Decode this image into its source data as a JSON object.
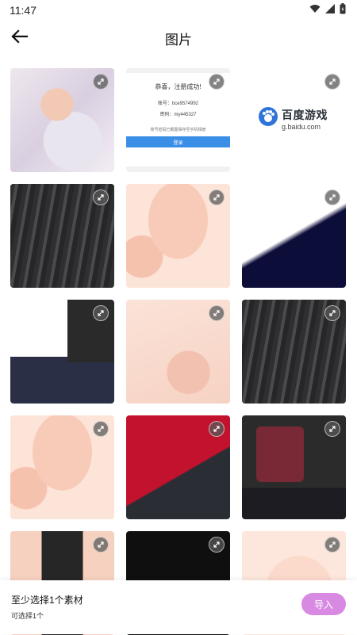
{
  "status_bar": {
    "time": "11:47",
    "icons": [
      "wifi-icon",
      "signal-icon",
      "battery-icon"
    ]
  },
  "app_bar": {
    "back_icon": "arrow-left-icon",
    "title": "图片"
  },
  "grid": {
    "tiles": [
      {
        "style": "cat"
      },
      {
        "style": "login",
        "card": {
          "title": "恭喜，注册成功!",
          "account": "账号：bce9574992",
          "password": "密码：my445327",
          "note": "账号密码已截图保存至手机相册",
          "button": "登录"
        }
      },
      {
        "style": "baidu",
        "logo": {
          "title": "百度游戏",
          "sub": "g.baidu.com"
        }
      },
      {
        "style": "dark"
      },
      {
        "style": "skin"
      },
      {
        "style": "navy"
      },
      {
        "style": "uniform"
      },
      {
        "style": "pale"
      },
      {
        "style": "dark"
      },
      {
        "style": "skin"
      },
      {
        "style": "red"
      },
      {
        "style": "outfit"
      },
      {
        "style": "legs"
      },
      {
        "style": "black"
      },
      {
        "style": "face"
      }
    ],
    "expand_icon": "expand-icon"
  },
  "bottom_bar": {
    "main_text": "至少选择1个素材",
    "sub_text": "可选择1个",
    "import_button": "导入"
  },
  "colors": {
    "accent": "#d88ae3",
    "login_button": "#3a8ee6"
  }
}
